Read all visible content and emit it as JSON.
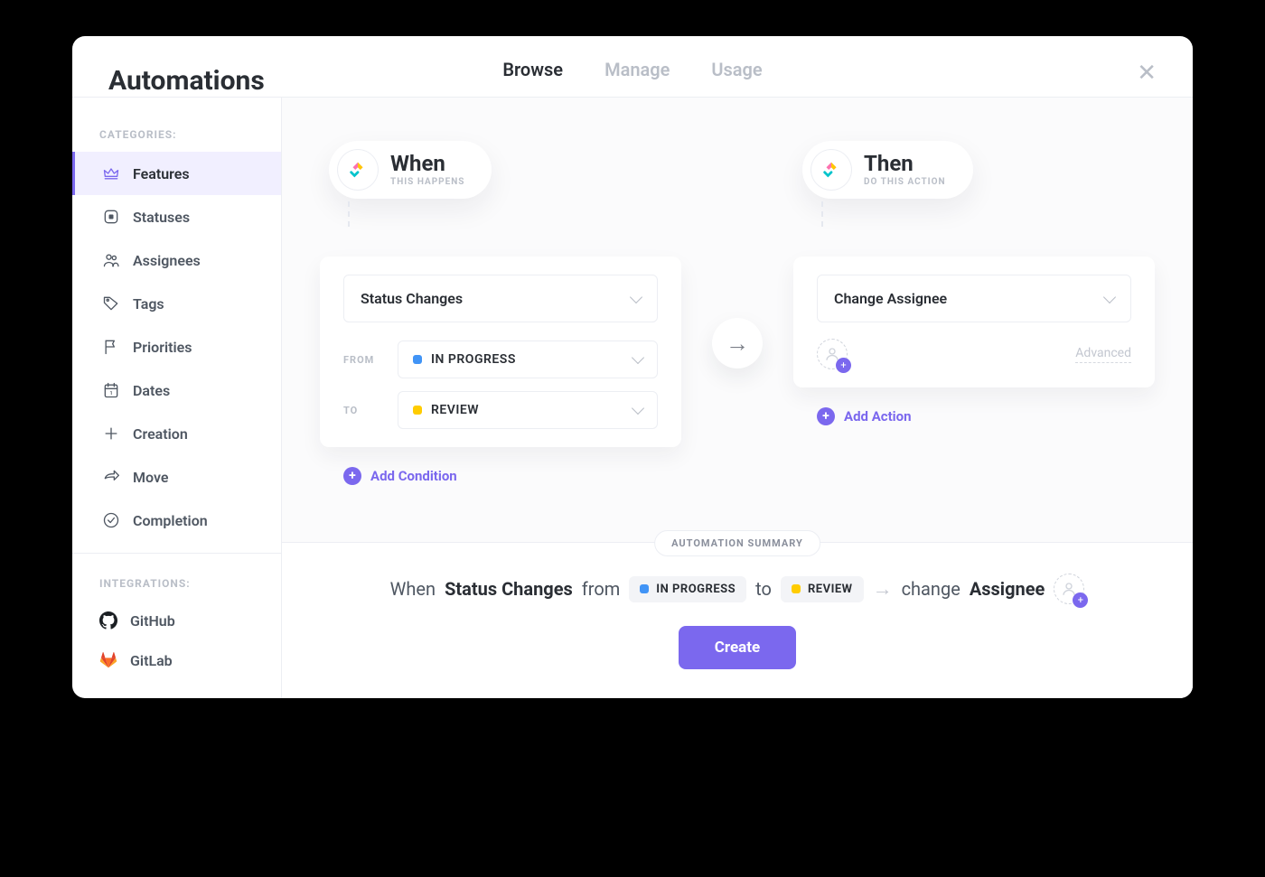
{
  "title": "Automations",
  "tabs": [
    "Browse",
    "Manage",
    "Usage"
  ],
  "activeTab": 0,
  "sidebar": {
    "categoriesLabel": "CATEGORIES:",
    "integrationsLabel": "INTEGRATIONS:",
    "categories": [
      {
        "label": "Features",
        "active": true
      },
      {
        "label": "Statuses"
      },
      {
        "label": "Assignees"
      },
      {
        "label": "Tags"
      },
      {
        "label": "Priorities"
      },
      {
        "label": "Dates"
      },
      {
        "label": "Creation"
      },
      {
        "label": "Move"
      },
      {
        "label": "Completion"
      }
    ],
    "integrations": [
      {
        "label": "GitHub"
      },
      {
        "label": "GitLab"
      }
    ]
  },
  "when": {
    "title": "When",
    "subtitle": "THIS HAPPENS",
    "trigger": "Status Changes",
    "fromLabel": "FROM",
    "toLabel": "TO",
    "fromStatus": {
      "name": "IN PROGRESS",
      "color": "#4194f6"
    },
    "toStatus": {
      "name": "REVIEW",
      "color": "#ffcc00"
    },
    "addCondition": "Add Condition"
  },
  "then": {
    "title": "Then",
    "subtitle": "DO THIS ACTION",
    "action": "Change Assignee",
    "advanced": "Advanced",
    "addAction": "Add Action"
  },
  "summary": {
    "chip": "AUTOMATION SUMMARY",
    "whenWord": "When",
    "trigger": "Status Changes",
    "fromWord": "from",
    "from": {
      "name": "IN PROGRESS",
      "color": "#4194f6"
    },
    "toWord": "to",
    "to": {
      "name": "REVIEW",
      "color": "#ffcc00"
    },
    "changeWord": "change",
    "target": "Assignee"
  },
  "createLabel": "Create"
}
